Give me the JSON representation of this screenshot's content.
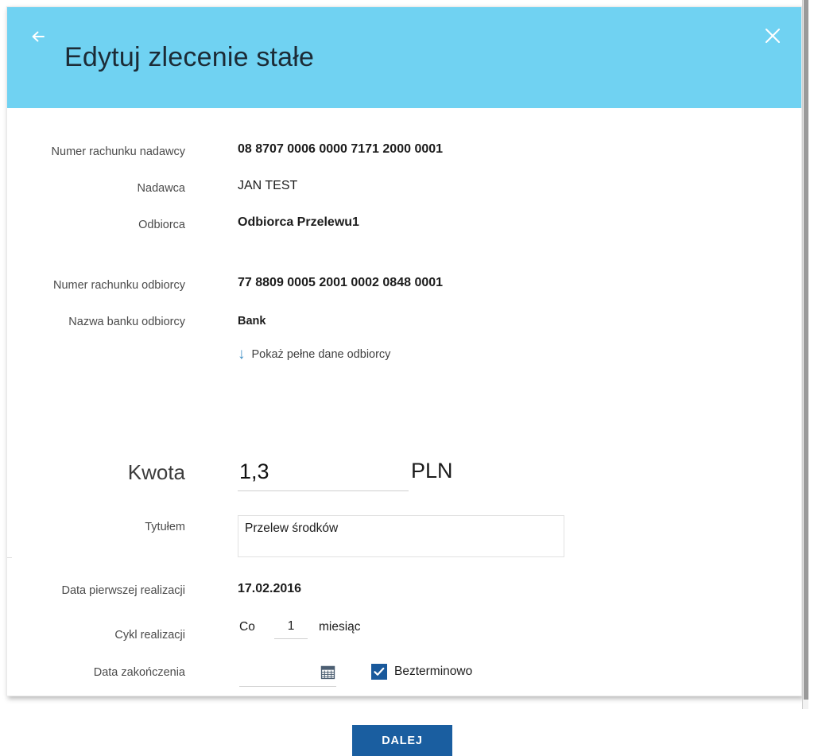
{
  "header": {
    "title": "Edytuj zlecenie stałe",
    "back_icon": "arrow-left-icon",
    "close_icon": "close-icon",
    "background_color": "#70d2f2",
    "title_color": "#1c2b36"
  },
  "form": {
    "fields": [
      {
        "label": "Numer rachunku nadawcy",
        "value": "08 8707 0006 0000 7171 2000 0001"
      },
      {
        "label": "Nadawca",
        "value": "JAN TEST"
      },
      {
        "label": "Odbiorca",
        "value": "Odbiorca Przelewu1"
      },
      {
        "label": "Numer rachunku odbiorcy",
        "value": "77 8809 0005 2001 0002 0848 0001"
      },
      {
        "label": "Nazwa banku odbiorcy",
        "value": "Bank"
      },
      {
        "label": "Data pierwszej realizacji",
        "value": "17.02.2016"
      }
    ],
    "show_recipient_link": {
      "text": "Pokaż pełne dane odbiorcy",
      "icon": "arrow-down-icon",
      "icon_color": "#3f8fc4"
    },
    "amount": {
      "label": "Kwota",
      "value": "1,3",
      "placeholder": "",
      "currency": "PLN"
    },
    "title_field": {
      "label": "Tytułem",
      "value": "Przelew środków",
      "placeholder": ""
    },
    "cycle": {
      "label": "Cykl realizacji",
      "prefix": "Co",
      "value": "1",
      "unit": "miesiąc"
    },
    "end_date": {
      "label": "Data zakończenia",
      "value": "",
      "placeholder": "",
      "calendar_icon": "calendar-icon",
      "indefinite_label": "Bezterminowo",
      "indefinite_checked": true,
      "checkbox_color": "#19599c"
    },
    "submit": {
      "label": "DALEJ",
      "color": "#1a5ea0"
    }
  }
}
